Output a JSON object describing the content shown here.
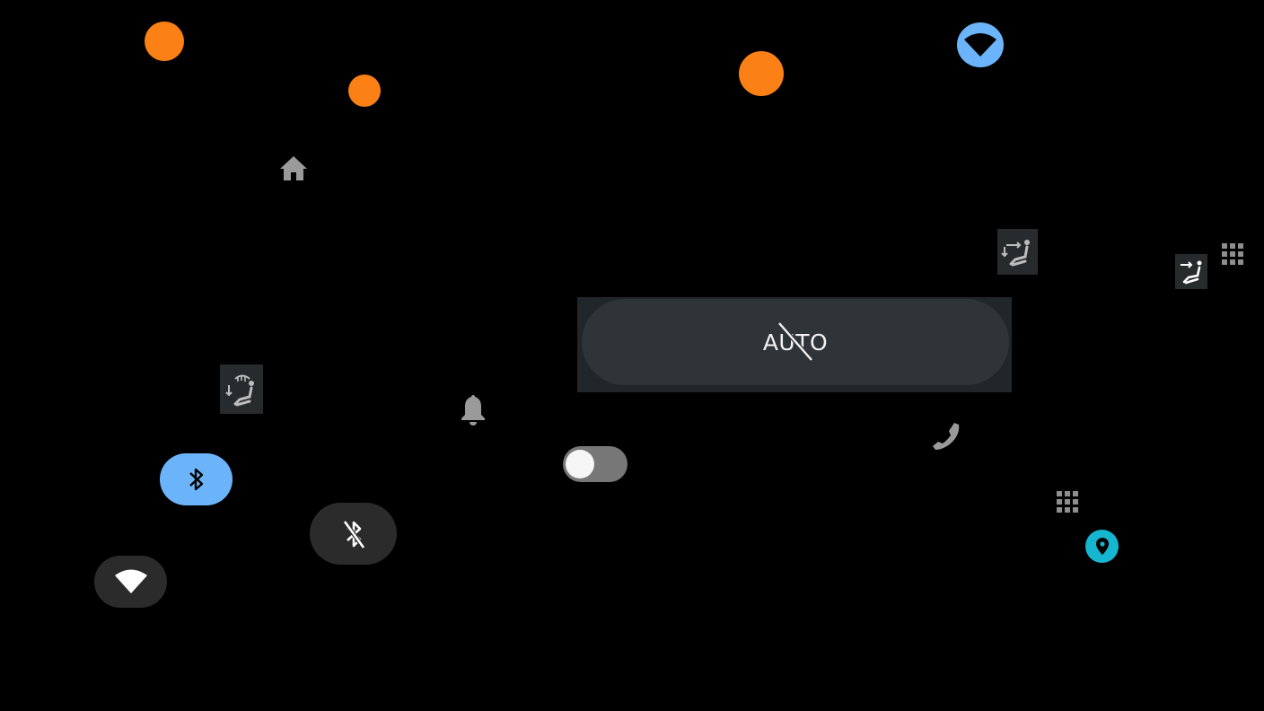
{
  "colors": {
    "background": "#000000",
    "launcher_orange": "#fb8015",
    "accent_blue": "#6cb4fa",
    "tile_dark": "#272b2e",
    "panel_bg": "#20262a",
    "pill_bg": "#2f3438",
    "icon_gray": "#9a9a9a",
    "toggle_track": "#777777",
    "toggle_knob": "#f5f5f5",
    "map_teal": "#16b6d0",
    "chip_dark": "#2b2b2c"
  },
  "icons": {
    "app_launcher": "app-grid-icon",
    "home": "home-icon",
    "notifications": "bell-icon",
    "phone": "phone-icon",
    "bluetooth_on": "bluetooth-icon",
    "bluetooth_off": "bluetooth-disabled-icon",
    "wifi": "wifi-icon",
    "map_pin": "map-pin-icon",
    "seat_airflow": "seat-airflow-icon",
    "seat_defrost": "seat-defrost-icon",
    "app_grid_small": "app-grid-small-icon"
  },
  "hvac": {
    "auto_label": "AUTO",
    "auto_state": "off"
  },
  "toggle": {
    "state": "off"
  }
}
